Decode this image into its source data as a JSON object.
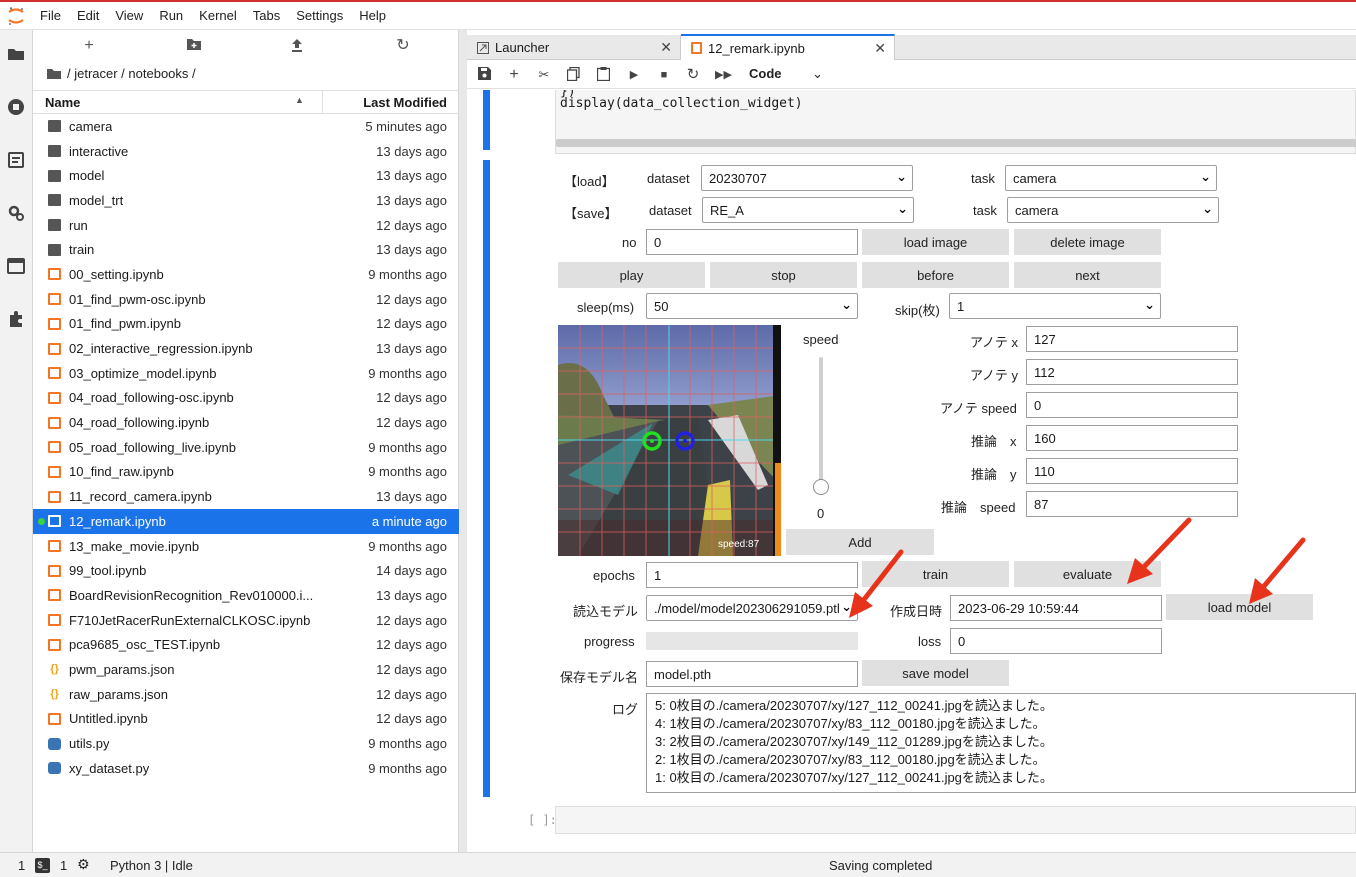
{
  "menubar": {
    "items": [
      "File",
      "Edit",
      "View",
      "Run",
      "Kernel",
      "Tabs",
      "Settings",
      "Help"
    ]
  },
  "activity": {
    "icons": [
      "folder-icon",
      "running-icon",
      "commands-icon",
      "property-inspector-icon",
      "tabs-icon",
      "extensions-icon"
    ]
  },
  "filebrowser": {
    "breadcrumb": "/ jetracer / notebooks /",
    "col_name": "Name",
    "col_modified": "Last Modified",
    "files": [
      {
        "name": "camera",
        "modified": "5 minutes ago",
        "type": "folder"
      },
      {
        "name": "interactive",
        "modified": "13 days ago",
        "type": "folder"
      },
      {
        "name": "model",
        "modified": "13 days ago",
        "type": "folder"
      },
      {
        "name": "model_trt",
        "modified": "13 days ago",
        "type": "folder"
      },
      {
        "name": "run",
        "modified": "12 days ago",
        "type": "folder"
      },
      {
        "name": "train",
        "modified": "13 days ago",
        "type": "folder"
      },
      {
        "name": "00_setting.ipynb",
        "modified": "9 months ago",
        "type": "notebook"
      },
      {
        "name": "01_find_pwm-osc.ipynb",
        "modified": "12 days ago",
        "type": "notebook"
      },
      {
        "name": "01_find_pwm.ipynb",
        "modified": "12 days ago",
        "type": "notebook"
      },
      {
        "name": "02_interactive_regression.ipynb",
        "modified": "13 days ago",
        "type": "notebook"
      },
      {
        "name": "03_optimize_model.ipynb",
        "modified": "9 months ago",
        "type": "notebook"
      },
      {
        "name": "04_road_following-osc.ipynb",
        "modified": "12 days ago",
        "type": "notebook"
      },
      {
        "name": "04_road_following.ipynb",
        "modified": "12 days ago",
        "type": "notebook"
      },
      {
        "name": "05_road_following_live.ipynb",
        "modified": "9 months ago",
        "type": "notebook"
      },
      {
        "name": "10_find_raw.ipynb",
        "modified": "9 months ago",
        "type": "notebook"
      },
      {
        "name": "11_record_camera.ipynb",
        "modified": "13 days ago",
        "type": "notebook"
      },
      {
        "name": "12_remark.ipynb",
        "modified": "a minute ago",
        "type": "notebook",
        "selected": true
      },
      {
        "name": "13_make_movie.ipynb",
        "modified": "9 months ago",
        "type": "notebook"
      },
      {
        "name": "99_tool.ipynb",
        "modified": "14 days ago",
        "type": "notebook"
      },
      {
        "name": "BoardRevisionRecognition_Rev010000.i...",
        "modified": "13 days ago",
        "type": "notebook"
      },
      {
        "name": "F710JetRacerRunExternalCLKOSC.ipynb",
        "modified": "12 days ago",
        "type": "notebook"
      },
      {
        "name": "pca9685_osc_TEST.ipynb",
        "modified": "12 days ago",
        "type": "notebook"
      },
      {
        "name": "pwm_params.json",
        "modified": "12 days ago",
        "type": "json"
      },
      {
        "name": "raw_params.json",
        "modified": "12 days ago",
        "type": "json"
      },
      {
        "name": "Untitled.ipynb",
        "modified": "12 days ago",
        "type": "notebook"
      },
      {
        "name": "utils.py",
        "modified": "9 months ago",
        "type": "python"
      },
      {
        "name": "xy_dataset.py",
        "modified": "9 months ago",
        "type": "python"
      }
    ]
  },
  "tabs": [
    {
      "label": "Launcher"
    },
    {
      "label": "12_remark.ipynb"
    }
  ],
  "nbtoolbar": {
    "cell_type": "Code"
  },
  "codecell": {
    "line1": "})",
    "line2": "display(data_collection_widget)"
  },
  "widget": {
    "load_label": "【load】",
    "save_label": "【save】",
    "dataset_label": "dataset",
    "task_label": "task",
    "load_dataset": "20230707",
    "load_task": "camera",
    "save_dataset": "RE_A",
    "save_task": "camera",
    "no_label": "no",
    "no_value": "0",
    "load_image": "load image",
    "delete_image": "delete image",
    "play": "play",
    "stop": "stop",
    "before": "before",
    "next": "next",
    "sleep_label": "sleep(ms)",
    "sleep_value": "50",
    "skip_label": "skip(枚)",
    "skip_value": "1",
    "speed_label": "speed",
    "speed_value": "0",
    "image_overlay_text": "speed:87",
    "add": "Add",
    "ann_x_label": "アノテ x",
    "ann_x": "127",
    "ann_y_label": "アノテ y",
    "ann_y": "112",
    "ann_speed_label": "アノテ speed",
    "ann_speed": "0",
    "inf_x_label": "推論　x",
    "inf_x": "160",
    "inf_y_label": "推論　y",
    "inf_y": "110",
    "inf_speed_label": "推論　speed",
    "inf_speed": "87",
    "epochs_label": "epochs",
    "epochs_value": "1",
    "train": "train",
    "evaluate": "evaluate",
    "model_label": "読込モデル",
    "model_value": "./model/model202306291059.pth",
    "created_label": "作成日時",
    "created_value": "2023-06-29 10:59:44",
    "load_model": "load model",
    "progress_label": "progress",
    "progress_value": 0,
    "loss_label": "loss",
    "loss_value": "0",
    "save_model_label": "保存モデル名",
    "save_model_value": "model.pth",
    "save_model": "save model",
    "log_label": "ログ",
    "log_lines": [
      "5: 0枚目の./camera/20230707/xy/127_112_00241.jpgを読込ました。",
      "4: 1枚目の./camera/20230707/xy/83_112_00180.jpgを読込ました。",
      "3: 2枚目の./camera/20230707/xy/149_112_01289.jpgを読込ました。",
      "2: 1枚目の./camera/20230707/xy/83_112_00180.jpgを読込ました。",
      "1: 0枚目の./camera/20230707/xy/127_112_00241.jpgを読込ました。"
    ]
  },
  "empty_cell_prompt": "[ ]:",
  "statusbar": {
    "num1": "1",
    "num2": "1",
    "kernel": "Python 3 | Idle",
    "status": "Saving completed"
  },
  "colors": {
    "accent": "#1a73e8",
    "notebook_icon": "#f37626",
    "arrow": "#e8331c"
  }
}
